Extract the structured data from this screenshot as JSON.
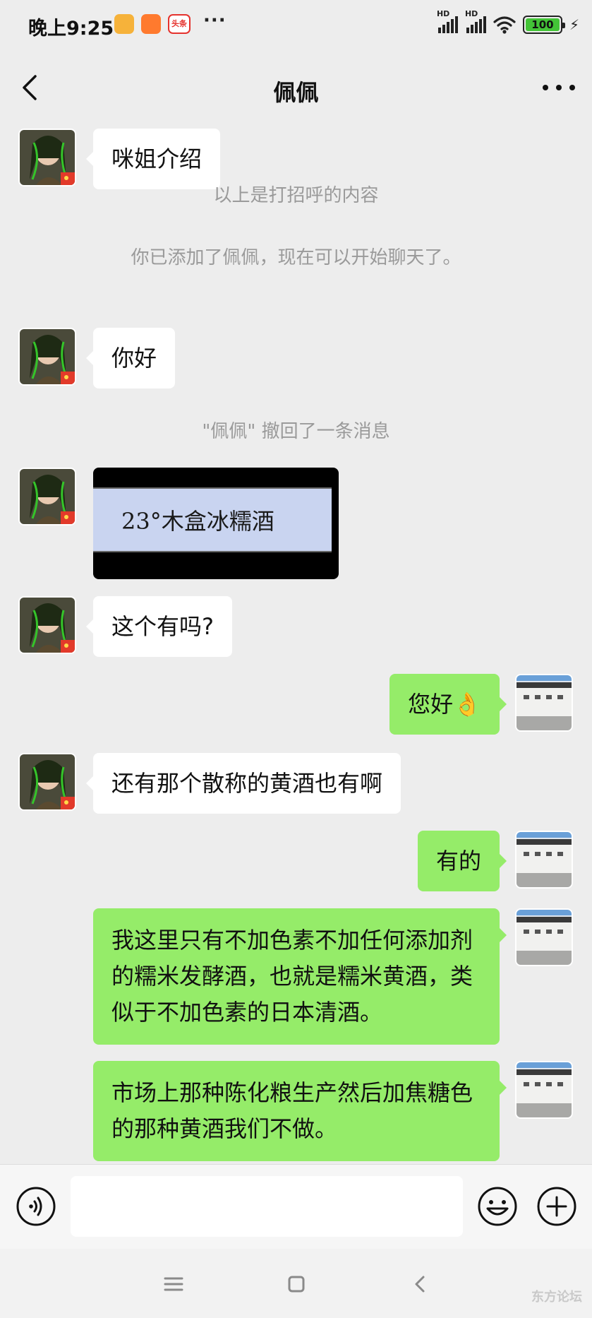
{
  "status_bar": {
    "time": "晚上9:25",
    "app_icons": [
      "",
      "",
      "头条"
    ],
    "more": "···",
    "signal_label_1": "HD",
    "signal_label_2": "HD",
    "battery": "100"
  },
  "header": {
    "title": "佩佩"
  },
  "messages": [
    {
      "type": "in",
      "text": "咪姐介绍"
    },
    {
      "type": "system",
      "text": "以上是打招呼的内容"
    },
    {
      "type": "system",
      "text": "你已添加了佩佩，现在可以开始聊天了。"
    },
    {
      "type": "in",
      "text": "你好"
    },
    {
      "type": "system",
      "text": "\"佩佩\" 撤回了一条消息"
    },
    {
      "type": "in-image",
      "text": "23°木盒冰糯酒"
    },
    {
      "type": "in",
      "text": "这个有吗?"
    },
    {
      "type": "out",
      "text": "您好👌"
    },
    {
      "type": "in",
      "text": "还有那个散称的黄酒也有啊"
    },
    {
      "type": "out",
      "text": "有的"
    },
    {
      "type": "out",
      "text": "我这里只有不加色素不加任何添加剂的糯米发酵酒，也就是糯米黄酒，类似于不加色素的日本清酒。"
    },
    {
      "type": "out",
      "text": "市场上那种陈化粮生产然后加焦糖色的那种黄酒我们不做。"
    }
  ],
  "input_bar": {
    "placeholder": "",
    "voice_icon": "voice-icon",
    "emoji_icon": "emoji-icon",
    "plus_icon": "plus-icon"
  },
  "nav_bar": {
    "watermark": "东方论坛"
  },
  "colors": {
    "background": "#ededed",
    "outgoing_bubble": "#95ec69",
    "incoming_bubble": "#ffffff",
    "system_text": "#9a9a9a"
  }
}
